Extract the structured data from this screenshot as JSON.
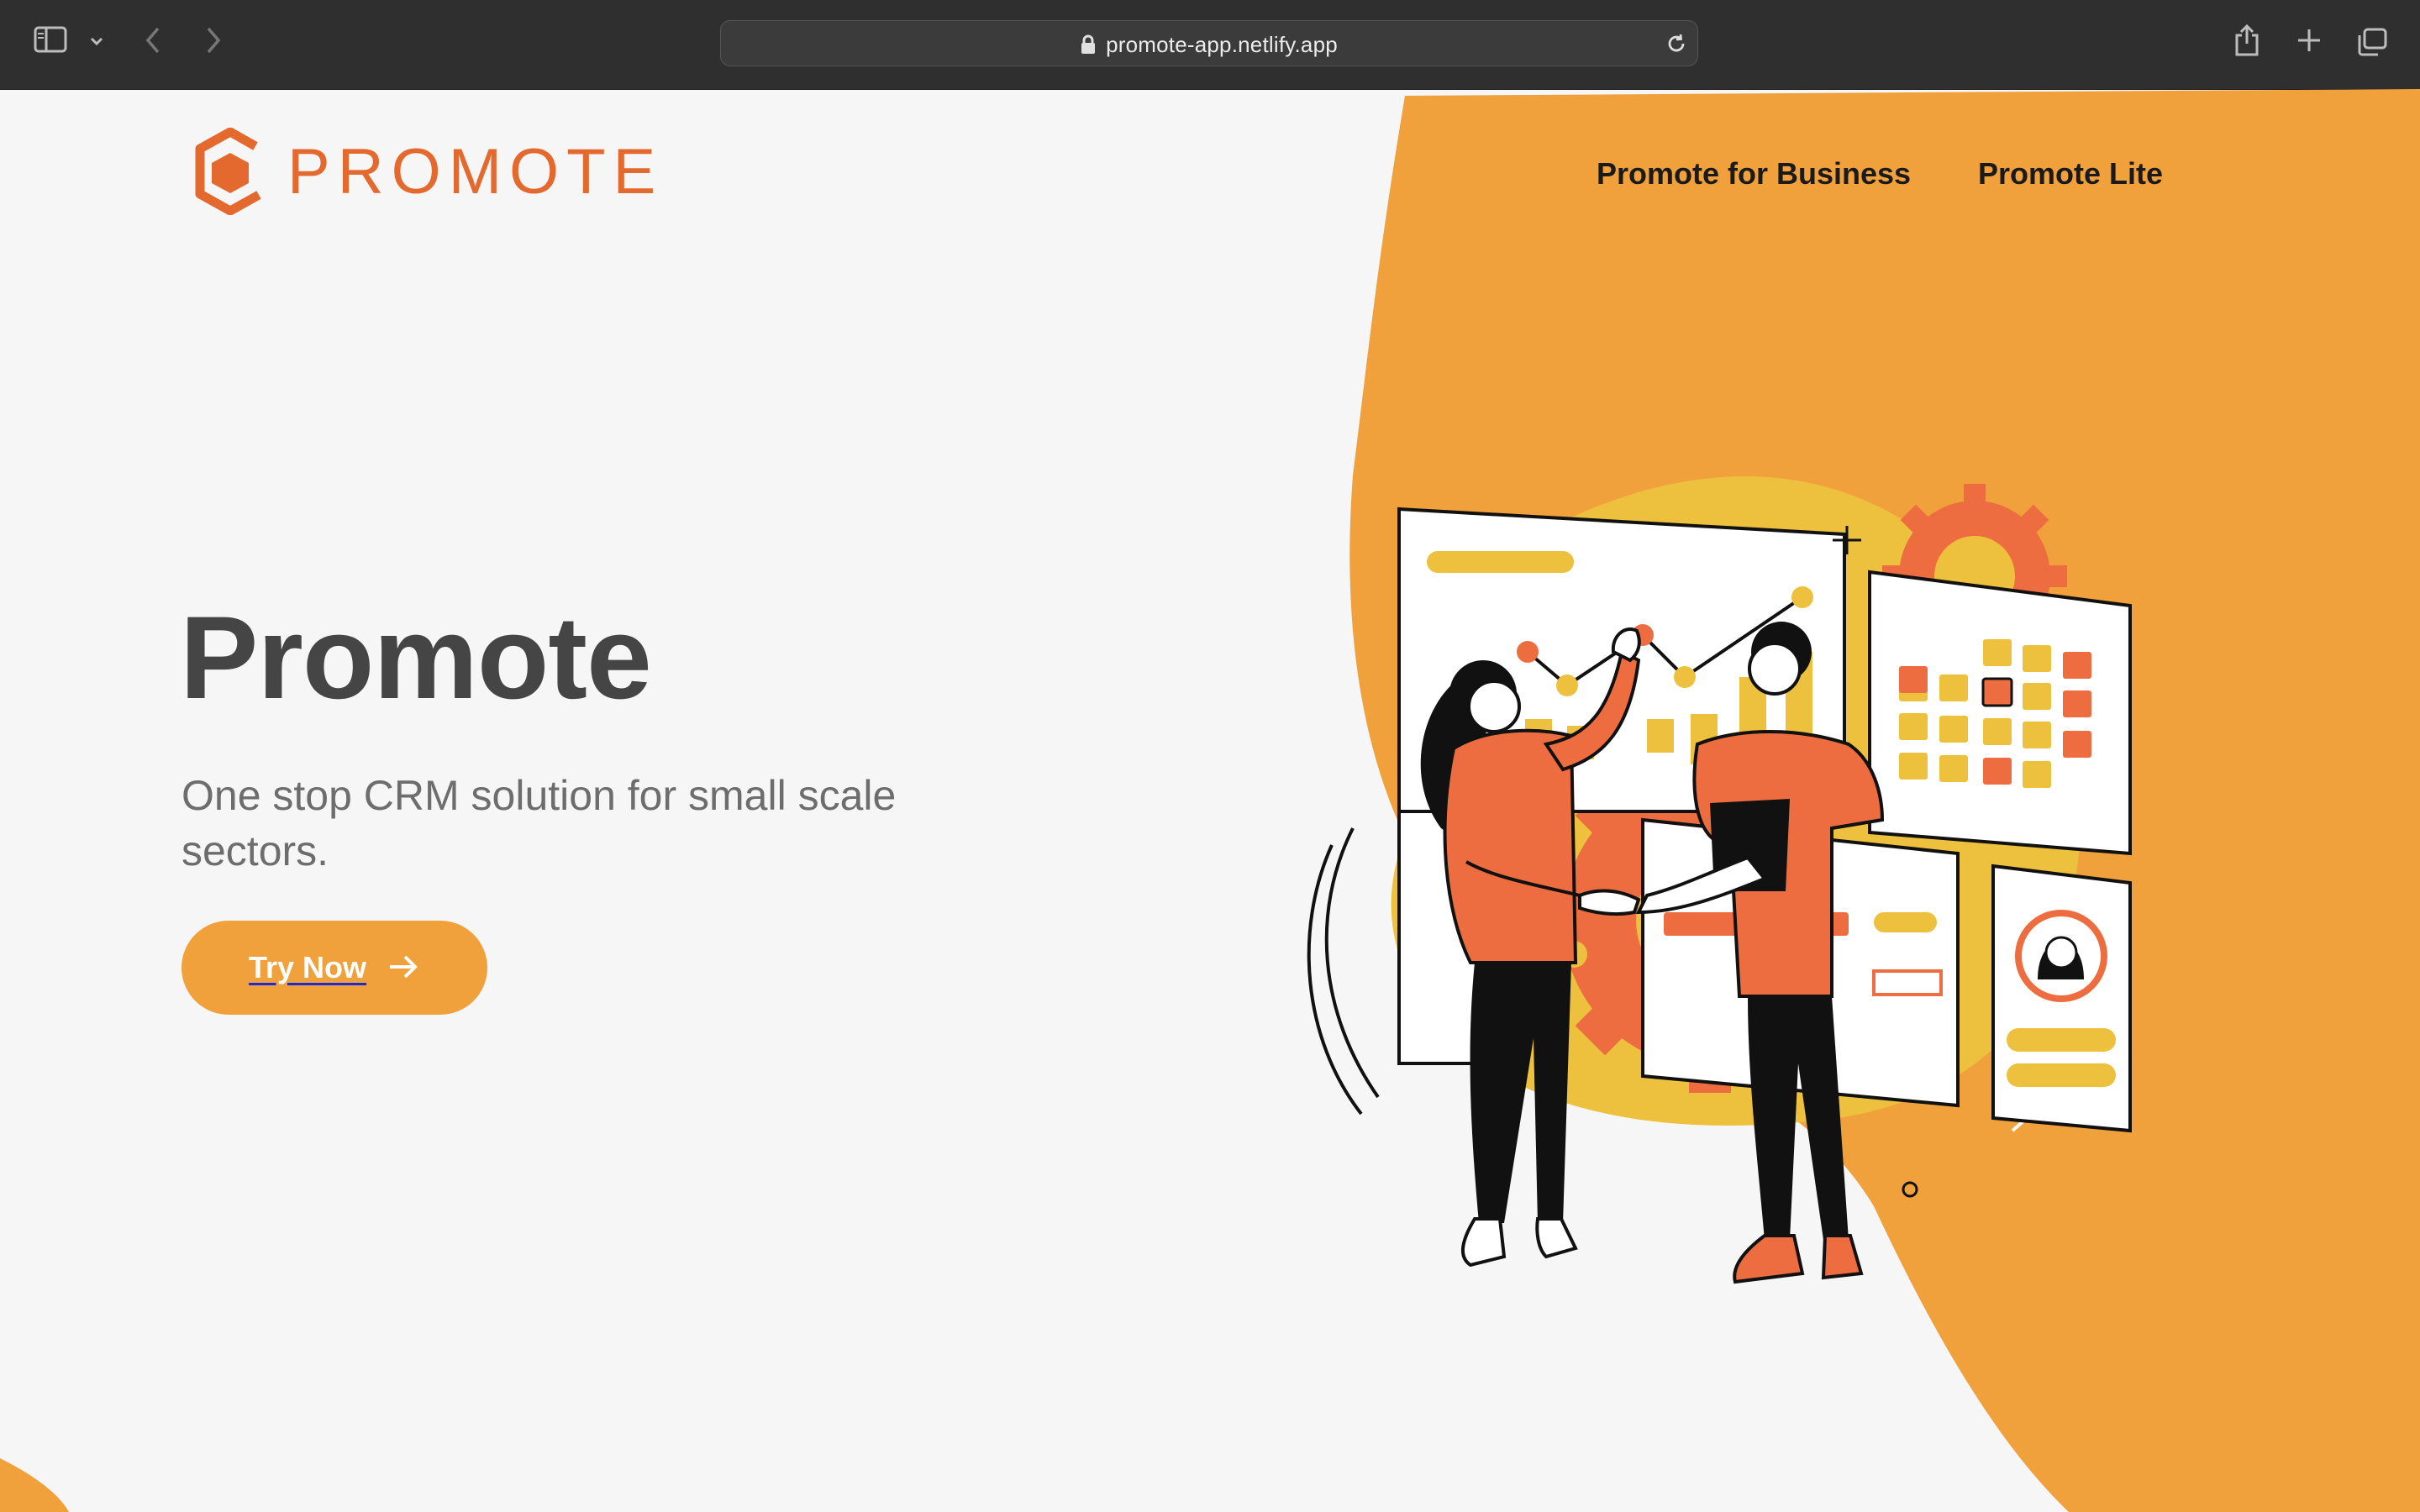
{
  "browser": {
    "url": "promote-app.netlify.app",
    "icons": [
      "sidebar-icon",
      "chevron-down-icon",
      "back-icon",
      "forward-icon",
      "lock-icon",
      "reload-icon",
      "share-icon",
      "new-tab-icon",
      "tabs-overview-icon"
    ]
  },
  "header": {
    "logo_text": "PROMOTE",
    "nav": [
      {
        "label": "Promote for Business"
      },
      {
        "label": "Promote Lite"
      }
    ]
  },
  "hero": {
    "title": "Promote",
    "subtitle": "One stop CRM solution for small scale sectors.",
    "cta_label": "Try Now",
    "cta_icon": "arrow-right-icon"
  },
  "colors": {
    "brand_orange": "#e4692f",
    "accent_orange": "#f0a13b",
    "illustration_yellow": "#edc13e",
    "illustration_orange": "#ee6d40",
    "background": "#f6f6f6"
  }
}
